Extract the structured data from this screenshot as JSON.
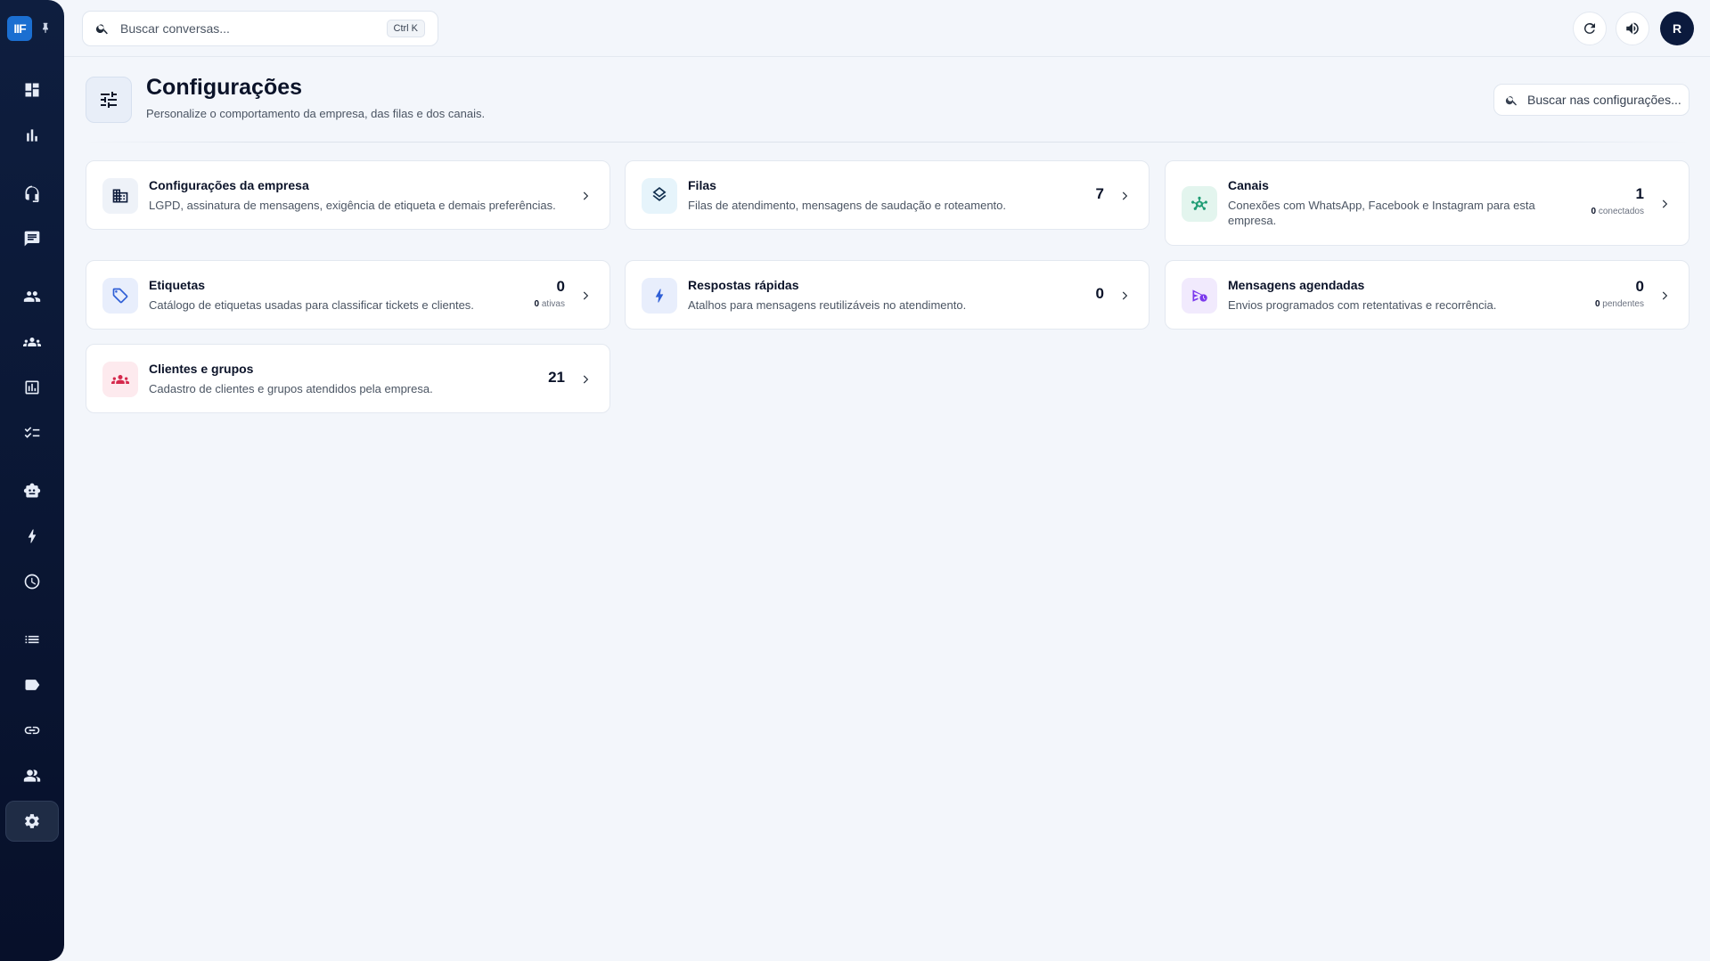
{
  "sidebar": {
    "logo_text": "IIF",
    "items": [
      {
        "icon": "dashboard-icon"
      },
      {
        "icon": "bar-chart-icon"
      },
      {
        "icon": "headset-icon"
      },
      {
        "icon": "chat-icon"
      },
      {
        "icon": "people-icon"
      },
      {
        "icon": "groups-icon"
      },
      {
        "icon": "report-icon"
      },
      {
        "icon": "checklist-icon"
      },
      {
        "icon": "robot-icon"
      },
      {
        "icon": "bolt-icon"
      },
      {
        "icon": "clock-icon"
      },
      {
        "icon": "list-icon"
      },
      {
        "icon": "tag-icon"
      },
      {
        "icon": "link-icon"
      },
      {
        "icon": "contacts-icon"
      },
      {
        "icon": "gear-icon",
        "active": true
      }
    ]
  },
  "topbar": {
    "search_placeholder": "Buscar conversas...",
    "shortcut": "Ctrl K",
    "avatar_initial": "R"
  },
  "header": {
    "title": "Configurações",
    "subtitle": "Personalize o comportamento da empresa, das filas e dos canais.",
    "search_placeholder": "Buscar nas configurações..."
  },
  "cards": {
    "empresa": {
      "title": "Configurações da empresa",
      "desc": "LGPD, assinatura de mensagens, exigência de etiqueta e demais preferências."
    },
    "filas": {
      "title": "Filas",
      "desc": "Filas de atendimento, mensagens de saudação e roteamento.",
      "count": "7"
    },
    "canais": {
      "title": "Canais",
      "desc": "Conexões com WhatsApp, Facebook e Instagram para esta empresa.",
      "count": "1",
      "sub_num": "0",
      "sub_label": "conectados"
    },
    "etiquetas": {
      "title": "Etiquetas",
      "desc": "Catálogo de etiquetas usadas para classificar tickets e clientes.",
      "count": "0",
      "sub_num": "0",
      "sub_label": "ativas"
    },
    "respostas": {
      "title": "Respostas rápidas",
      "desc": "Atalhos para mensagens reutilizáveis no atendimento.",
      "count": "0"
    },
    "agendadas": {
      "title": "Mensagens agendadas",
      "desc": "Envios programados com retentativas e recorrência.",
      "count": "0",
      "sub_num": "0",
      "sub_label": "pendentes"
    },
    "clientes": {
      "title": "Clientes e grupos",
      "desc": "Cadastro de clientes e grupos atendidos pela empresa.",
      "count": "21"
    }
  },
  "colors": {
    "sidebar_bg": "#0e1e3f",
    "accent_blue": "#1b6fd1",
    "canais_green": "#1f9d74",
    "etiquetas_blue": "#2f5fd6",
    "agendadas_purple": "#7c3aed",
    "clientes_red": "#d5284c"
  }
}
